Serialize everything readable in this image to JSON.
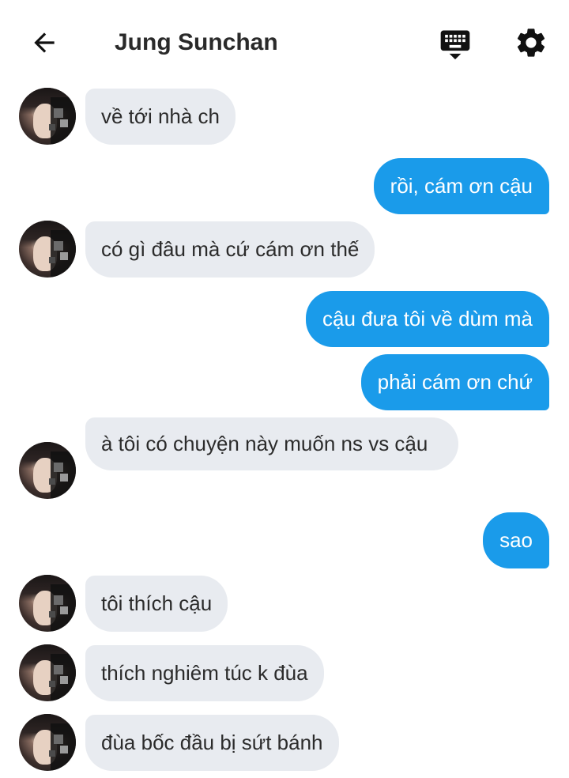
{
  "header": {
    "contact_name": "Jung Sunchan",
    "back_icon": "arrow-left-icon",
    "keyboard_icon": "keyboard-icon",
    "settings_icon": "gear-icon"
  },
  "colors": {
    "outgoing_bubble": "#1a9bea",
    "incoming_bubble": "#e8ebf0",
    "text_dark": "#2b2b2b",
    "text_light": "#ffffff"
  },
  "messages": [
    {
      "from": "contact",
      "text": "về tới nhà ch"
    },
    {
      "from": "me",
      "text": "rồi, cám ơn cậu"
    },
    {
      "from": "contact",
      "text": "có gì đâu mà cứ cám ơn thế"
    },
    {
      "from": "me",
      "text": "cậu đưa tôi về dùm mà"
    },
    {
      "from": "me",
      "text": "phải cám ơn chứ"
    },
    {
      "from": "contact",
      "text": "à tôi có chuyện này muốn ns vs cậu"
    },
    {
      "from": "me",
      "text": "sao"
    },
    {
      "from": "contact",
      "text": "tôi thích cậu"
    },
    {
      "from": "contact",
      "text": "thích nghiêm túc k đùa"
    },
    {
      "from": "contact",
      "text": "đùa bốc đầu bị sứt bánh"
    }
  ]
}
